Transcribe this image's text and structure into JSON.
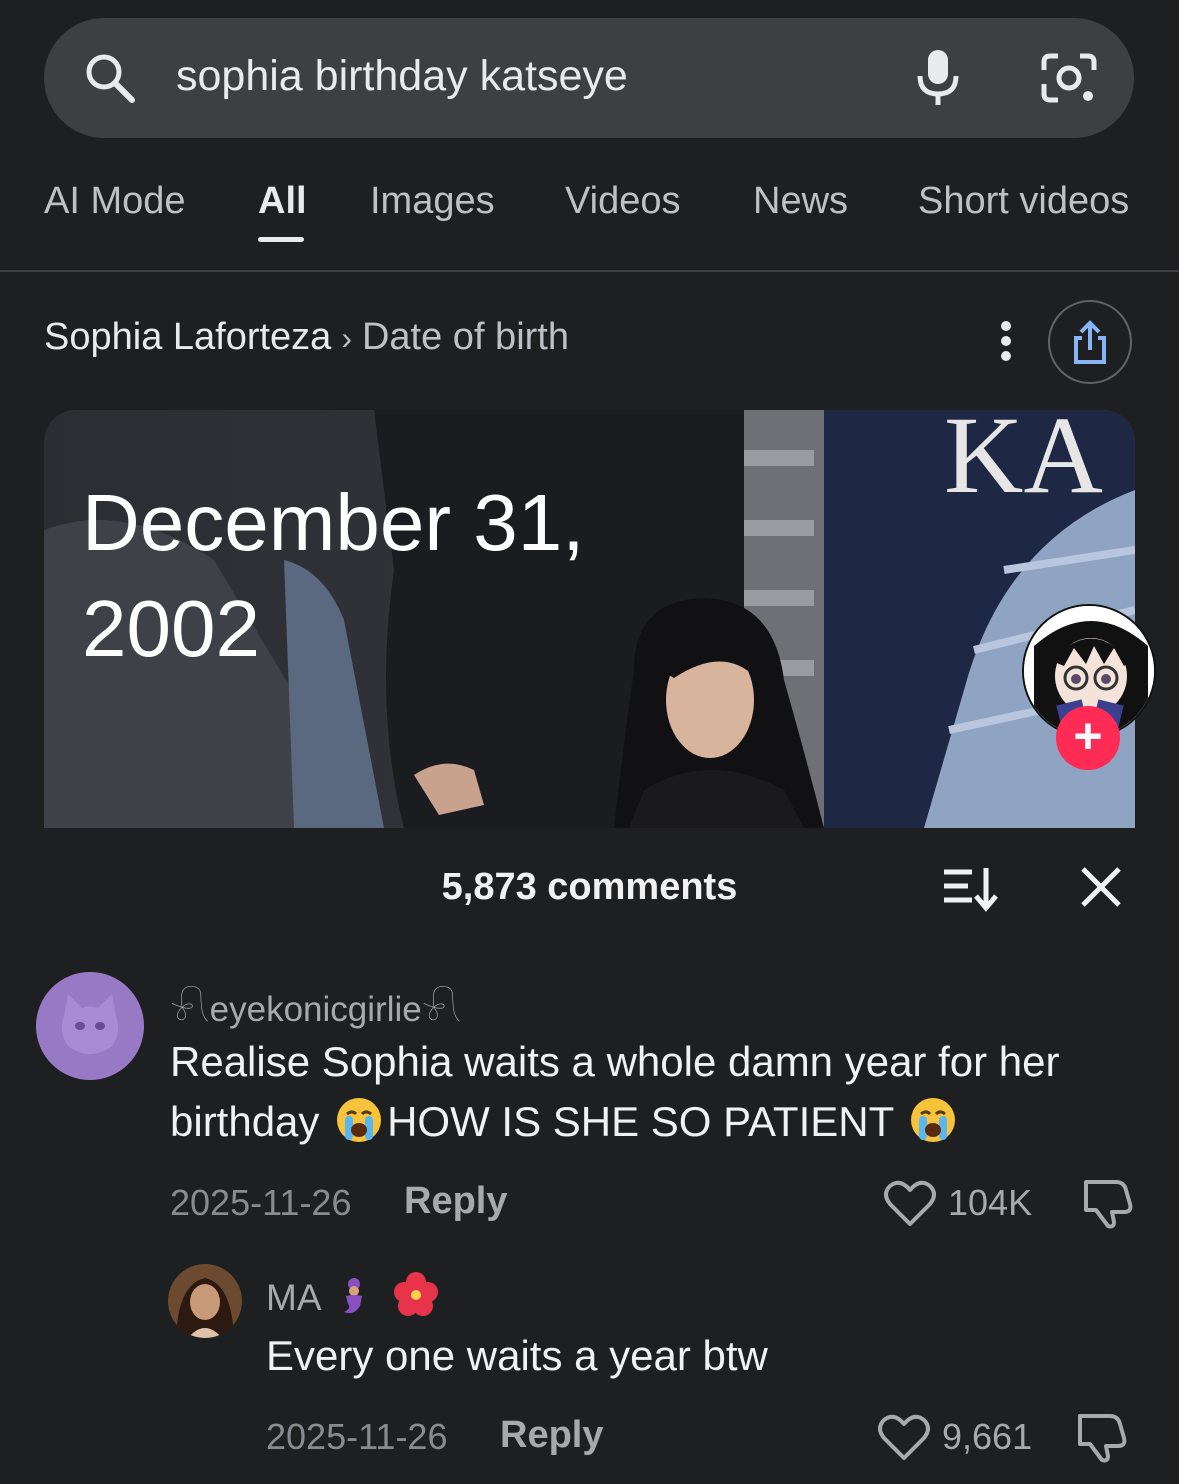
{
  "search": {
    "query": "sophia birthday katseye",
    "icons": [
      "search-icon",
      "mic-icon",
      "lens-icon"
    ]
  },
  "tabs": [
    {
      "label": "AI Mode",
      "active": false
    },
    {
      "label": "All",
      "active": true
    },
    {
      "label": "Images",
      "active": false
    },
    {
      "label": "Videos",
      "active": false
    },
    {
      "label": "News",
      "active": false
    },
    {
      "label": "Short videos",
      "active": false
    }
  ],
  "knowledge": {
    "entity": "Sophia Laforteza",
    "separator": "›",
    "attribute": "Date of birth",
    "answer": "December 31,\n2002",
    "card_overlay_text": "KA"
  },
  "comments_panel": {
    "count_label": "5,873 comments",
    "comments": [
      {
        "username": "𓍯eyekonicgirlie𓍯",
        "text_part1": "Realise Sophia waits a whole damn year for her birthday ",
        "text_part2": "HOW IS SHE SO PATIENT ",
        "date": "2025-11-26",
        "reply_label": "Reply",
        "likes": "104K"
      },
      {
        "username": "MA",
        "text": "Every one waits a year btw",
        "date": "2025-11-26",
        "reply_label": "Reply",
        "likes": "9,661"
      }
    ]
  },
  "colors": {
    "background": "#1e1f20",
    "search_bar": "#3c4043",
    "follow_red": "#fe2c55",
    "muted_text": "#a8a9ad"
  }
}
